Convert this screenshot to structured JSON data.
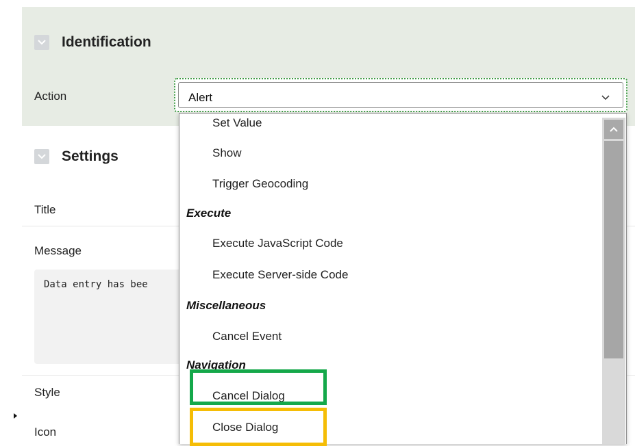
{
  "identification": {
    "title": "Identification",
    "action_label": "Action",
    "action_value": "Alert"
  },
  "settings": {
    "title": "Settings",
    "title_label": "Title",
    "message_label": "Message",
    "message_text": "Data entry has bee",
    "style_label": "Style",
    "icon_label": "Icon"
  },
  "dropdown": {
    "items": [
      {
        "type": "option",
        "label": "Set Value"
      },
      {
        "type": "option",
        "label": "Show"
      },
      {
        "type": "option",
        "label": "Trigger Geocoding"
      },
      {
        "type": "group",
        "label": "Execute"
      },
      {
        "type": "option",
        "label": "Execute JavaScript Code"
      },
      {
        "type": "option",
        "label": "Execute Server-side Code"
      },
      {
        "type": "group",
        "label": "Miscellaneous"
      },
      {
        "type": "option",
        "label": "Cancel Event"
      },
      {
        "type": "group",
        "label": "Navigation"
      },
      {
        "type": "option",
        "label": "Cancel Dialog"
      },
      {
        "type": "option",
        "label": "Close Dialog"
      }
    ]
  },
  "colors": {
    "identification_bg": "#e7ece4",
    "focus_outline": "#3f9b44",
    "highlight_green": "#14a84a",
    "highlight_yellow": "#f5bd06"
  },
  "icons": {
    "collapse": "chevron-down-icon",
    "select": "chevron-down-icon",
    "scroll_up": "chevron-up-icon"
  }
}
